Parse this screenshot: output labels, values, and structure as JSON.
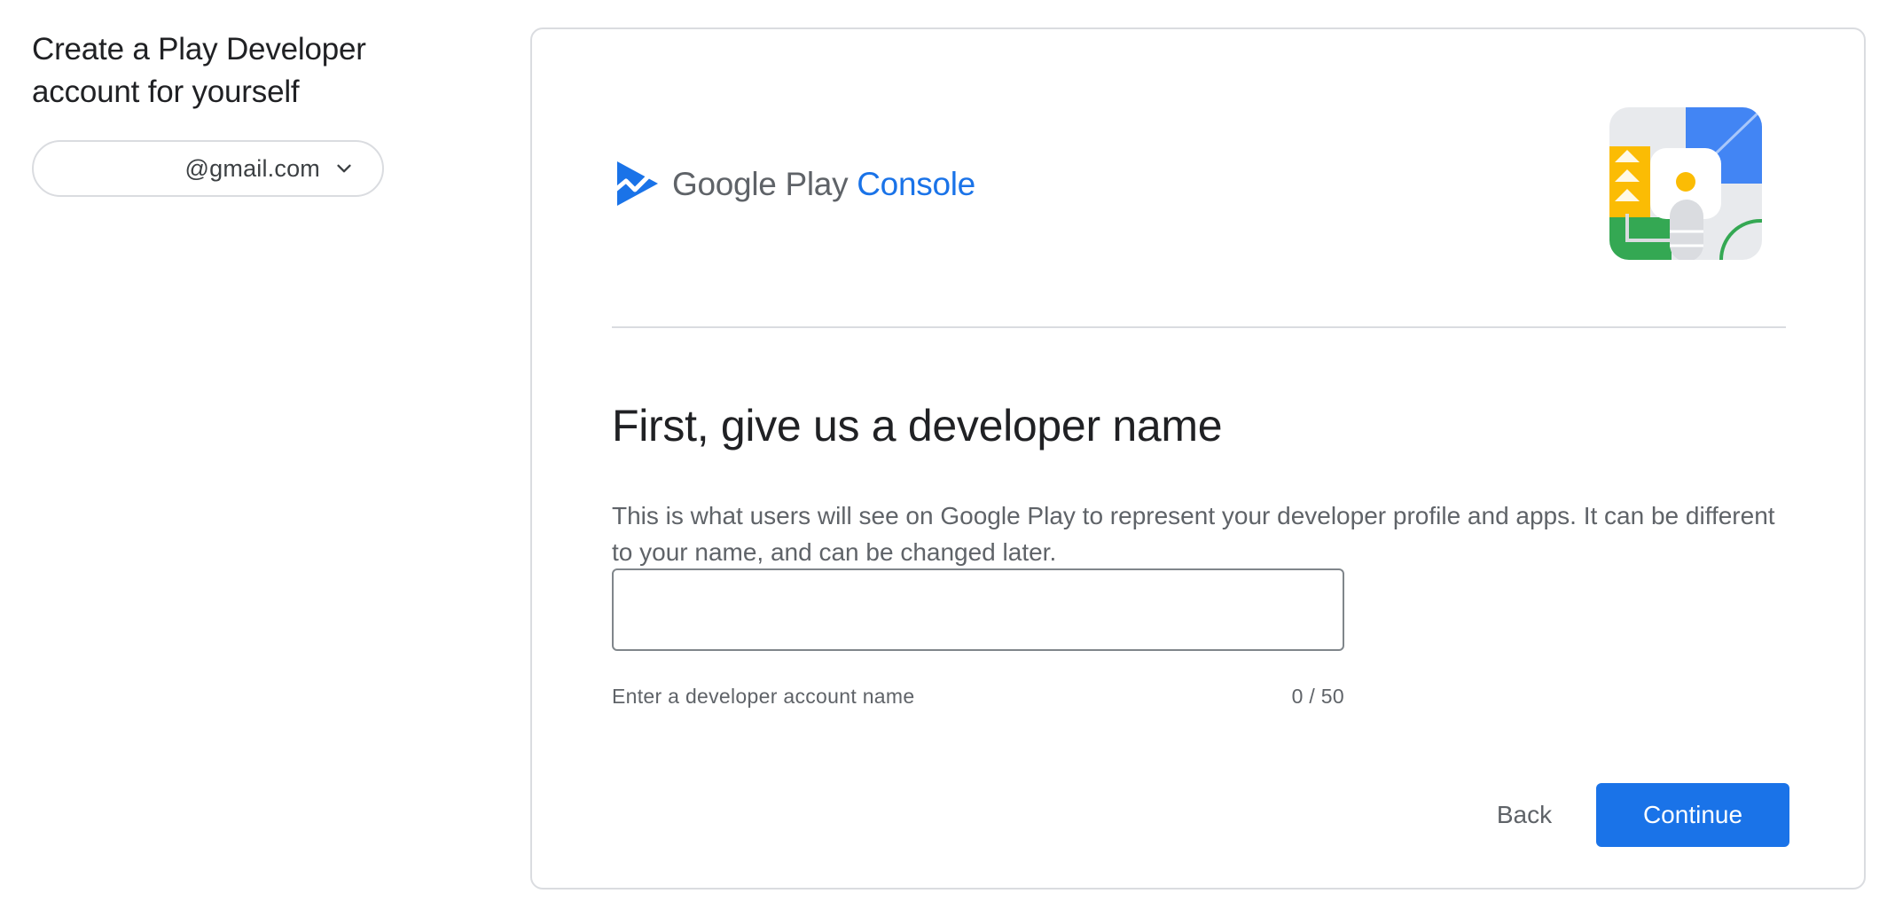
{
  "left_panel": {
    "title": "Create a Play Developer account for yourself",
    "account_email": "@gmail.com"
  },
  "brand": {
    "google_play": "Google Play",
    "console": "Console"
  },
  "form": {
    "heading": "First, give us a developer name",
    "description": "This is what users will see on Google Play to represent your developer profile and apps. It can be different to your name, and can be changed later.",
    "input_value": "",
    "hint": "Enter a developer account name",
    "counter": "0 / 50"
  },
  "actions": {
    "back_label": "Back",
    "continue_label": "Continue"
  },
  "colors": {
    "accent": "#1a73e8",
    "text_primary": "#202124",
    "text_secondary": "#5f6368",
    "border": "#dadce0"
  },
  "icons": {
    "account_chevron": "chevron-down-icon",
    "brand_logo": "play-console-logo-icon"
  }
}
